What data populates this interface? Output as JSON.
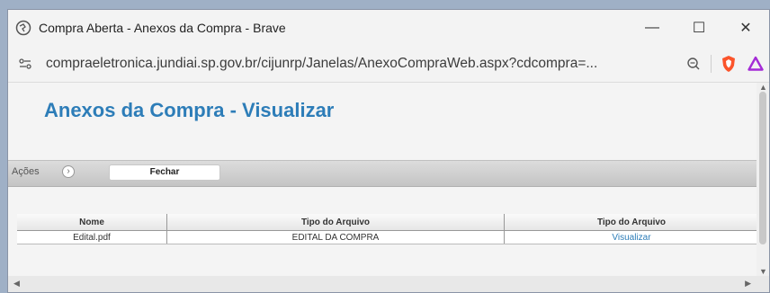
{
  "window": {
    "title": "Compra Aberta - Anexos da Compra - Brave",
    "minimize": "—",
    "maximize": "☐",
    "close": "✕"
  },
  "browser": {
    "url": "compraeletronica.jundiai.sp.gov.br/cijunrp/Janelas/AnexoCompraWeb.aspx?cdcompra=..."
  },
  "page": {
    "title": "Anexos da Compra - Visualizar"
  },
  "actions": {
    "label": "Ações",
    "fechar": "Fechar"
  },
  "table": {
    "headers": [
      "Nome",
      "Tipo do Arquivo",
      "Tipo do Arquivo"
    ],
    "rows": [
      {
        "nome": "Edital.pdf",
        "tipo": "EDITAL DA COMPRA",
        "acao": "Visualizar"
      }
    ]
  },
  "colors": {
    "accent": "#2d7db8",
    "brave": "#fb542b"
  }
}
